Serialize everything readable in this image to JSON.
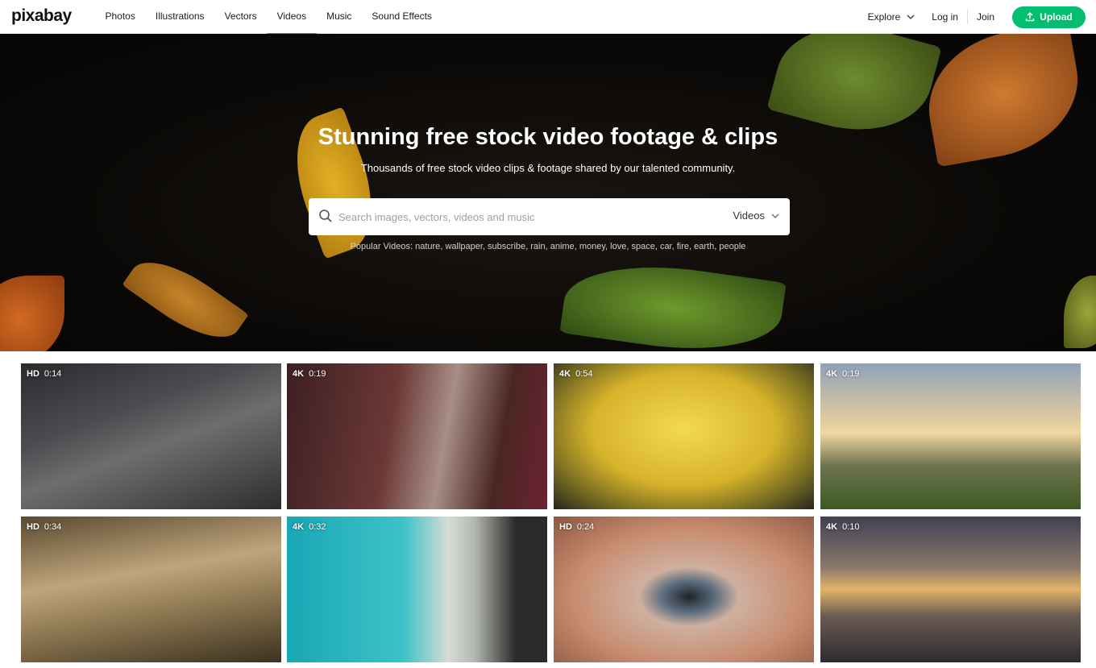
{
  "header": {
    "logo": "pixabay",
    "nav": [
      "Photos",
      "Illustrations",
      "Vectors",
      "Videos",
      "Music",
      "Sound Effects"
    ],
    "active_nav": "Videos",
    "explore_label": "Explore",
    "login_label": "Log in",
    "join_label": "Join",
    "upload_label": "Upload"
  },
  "hero": {
    "title": "Stunning free stock video footage & clips",
    "subtitle": "Thousands of free stock video clips & footage shared by our talented community.",
    "search_placeholder": "Search images, vectors, videos and music",
    "search_type": "Videos",
    "popular_label": "Popular Videos:",
    "popular_tags": [
      "nature",
      "wallpaper",
      "subscribe",
      "rain",
      "anime",
      "money",
      "love",
      "space",
      "car",
      "fire",
      "earth",
      "people"
    ]
  },
  "videos": [
    {
      "quality": "HD",
      "duration": "0:14"
    },
    {
      "quality": "4K",
      "duration": "0:19"
    },
    {
      "quality": "4K",
      "duration": "0:54"
    },
    {
      "quality": "4K",
      "duration": "0:19"
    },
    {
      "quality": "HD",
      "duration": "0:34"
    },
    {
      "quality": "4K",
      "duration": "0:32"
    },
    {
      "quality": "HD",
      "duration": "0:24"
    },
    {
      "quality": "4K",
      "duration": "0:10"
    }
  ],
  "colors": {
    "accent": "#02be6e"
  }
}
